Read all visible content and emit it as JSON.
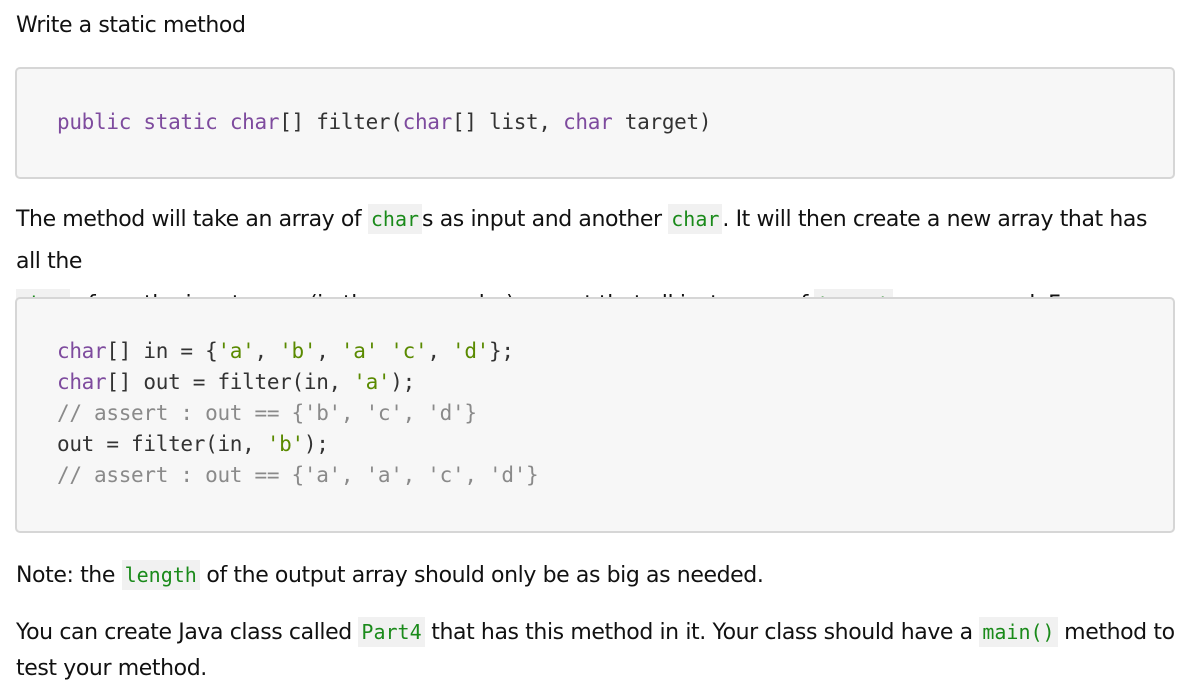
{
  "intro": {
    "text": "Write a static method"
  },
  "signature": {
    "tokens": [
      {
        "t": "public",
        "k": "kw"
      },
      {
        "t": " "
      },
      {
        "t": "static",
        "k": "kw"
      },
      {
        "t": " "
      },
      {
        "t": "char",
        "k": "kw"
      },
      {
        "t": "[] filter("
      },
      {
        "t": "char",
        "k": "kw"
      },
      {
        "t": "[] list, "
      },
      {
        "t": "char",
        "k": "kw"
      },
      {
        "t": " target)"
      }
    ]
  },
  "description": {
    "line1_a": "The method will take an array of ",
    "code_char1": "char",
    "line1_b": "s as input and another ",
    "code_char2": "char",
    "line1_c": ". It will then create a new array that has all the",
    "code_char3": "char",
    "line2_a": "s from the input array (in the same order) except that all instances of ",
    "code_target": "target",
    "line2_b": " are removed. For example,"
  },
  "example": {
    "lines": [
      [
        {
          "t": "char",
          "k": "kw"
        },
        {
          "t": "[] in = {"
        },
        {
          "t": "'a'",
          "k": "str"
        },
        {
          "t": ", "
        },
        {
          "t": "'b'",
          "k": "str"
        },
        {
          "t": ", "
        },
        {
          "t": "'a'",
          "k": "str"
        },
        {
          "t": " "
        },
        {
          "t": "'c'",
          "k": "str"
        },
        {
          "t": ", "
        },
        {
          "t": "'d'",
          "k": "str"
        },
        {
          "t": "};"
        }
      ],
      [
        {
          "t": "char",
          "k": "kw"
        },
        {
          "t": "[] out = filter(in, "
        },
        {
          "t": "'a'",
          "k": "str"
        },
        {
          "t": ");"
        }
      ],
      [
        {
          "t": "// assert : out == {'b', 'c', 'd'}",
          "k": "cm"
        }
      ],
      [
        {
          "t": "out = filter(in, "
        },
        {
          "t": "'b'",
          "k": "str"
        },
        {
          "t": ");"
        }
      ],
      [
        {
          "t": "// assert : out == {'a', 'a', 'c', 'd'}",
          "k": "cm"
        }
      ]
    ]
  },
  "note": {
    "a": "Note: the ",
    "code_length": "length",
    "b": " of the output array should only be as big as needed."
  },
  "instructions": {
    "a": "You can create Java class called ",
    "code_class": "Part4",
    "b": " that has this method in it. Your class should have a ",
    "code_main": "main()",
    "c": " method to",
    "d": "test your method."
  }
}
